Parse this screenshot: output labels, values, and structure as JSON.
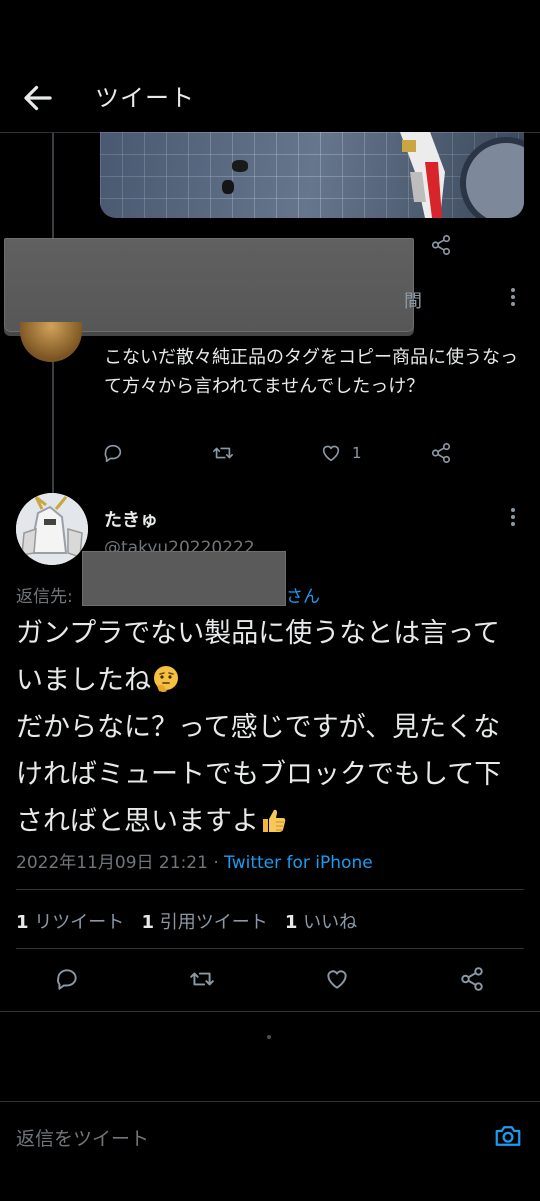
{
  "header": {
    "title": "ツイート"
  },
  "parent_reply": {
    "partial_visible_char": "間",
    "text": "こないだ散々純正品のタグをコピー商品に使うなって方々から言われてませんでしたっけ？",
    "like_count": "1"
  },
  "tweet": {
    "author_name": "たきゅ",
    "author_handle": "@takyu20220222",
    "reply_to_prefix": "返信先:",
    "reply_to_suffix": "さん",
    "text_line1": "ガンプラでない製品に使うなとは言っていましたね",
    "text_line2": "だからなに？って感じですが、見たくなければミュートでもブロックでもして下さればと思いますよ",
    "timestamp": "2022年11月09日 21:21 · ",
    "source": "Twitter for iPhone",
    "stats": {
      "retweets_count": "1",
      "retweets_label": "リツイート",
      "quotes_count": "1",
      "quotes_label": "引用ツイート",
      "likes_count": "1",
      "likes_label": "いいね"
    }
  },
  "reply_bar": {
    "placeholder": "返信をツイート"
  },
  "colors": {
    "background": "#000000",
    "accent": "#1d9bf0",
    "secondary_text": "#71767b"
  },
  "icons": [
    "back-arrow-icon",
    "reply-icon",
    "retweet-icon",
    "like-icon",
    "share-icon",
    "more-icon",
    "camera-icon",
    "thinking-face-emoji",
    "thumbs-up-emoji"
  ]
}
